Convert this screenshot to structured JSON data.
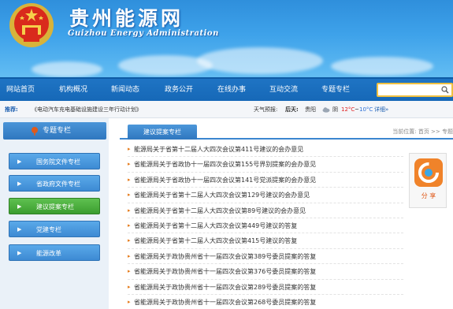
{
  "header": {
    "title": "贵州能源网",
    "subtitle": "Guizhou Energy Administration"
  },
  "nav": {
    "items": [
      "网站首页",
      "机构概况",
      "新闻动态",
      "政务公开",
      "在线办事",
      "互动交流",
      "专题专栏"
    ]
  },
  "info_bar": {
    "recommend_label": "推荐:",
    "recommend_text": "《电动汽车充电基础设施建设三年行动计划》",
    "weather_label": "天气预报:",
    "day_label": "后天:",
    "city": "贵阳",
    "weather_glyph": "阴",
    "temp_high": "12°C",
    "temp_sep": "~",
    "temp_low": "10°C",
    "detail_link": "详细»"
  },
  "sidebar": {
    "heading": "专题专栏",
    "items": [
      {
        "label": "国务院文件专栏",
        "active": false
      },
      {
        "label": "省政府文件专栏",
        "active": false
      },
      {
        "label": "建议提案专栏",
        "active": true
      },
      {
        "label": "党建专栏",
        "active": false
      },
      {
        "label": "能源改革",
        "active": false
      }
    ]
  },
  "main": {
    "tab_label": "建议提案专栏",
    "breadcrumb": "当前位置: 首页 >> 专题",
    "list": [
      "能源局关于省第十二届人大四次会议第411号建议的会办意见",
      "省能源局关于省政协十一届四次会议第155号界别提案的会办意见",
      "省能源局关于省政协十一届四次会议第141号党派提案的会办意见",
      "省能源局关于省第十二届人大四次会议第129号建议的会办意见",
      "省能源局关于省第十二届人大四次会议第89号建议的会办意见",
      "省能源局关于省第十二届人大四次会议第449号建议的答复",
      "省能源局关于省第十二届人大四次会议第415号建议的答复",
      "省能源局关于政协贵州省十一届四次会议第389号委员提案的答复",
      "省能源局关于政协贵州省十一届四次会议第376号委员提案的答复",
      "省能源局关于政协贵州省十一届四次会议第289号委员提案的答复",
      "省能源局关于政协贵州省十一届四次会议第268号委员提案的答复"
    ]
  },
  "share": {
    "label": "分 享"
  },
  "colors": {
    "header_blue": "#3ea2ea",
    "nav_blue": "#1668b7",
    "active_green": "#3b9d2f",
    "bullet_orange": "#e57b1a",
    "temp_red": "#e02020",
    "temp_blue": "#2a6fd6"
  }
}
